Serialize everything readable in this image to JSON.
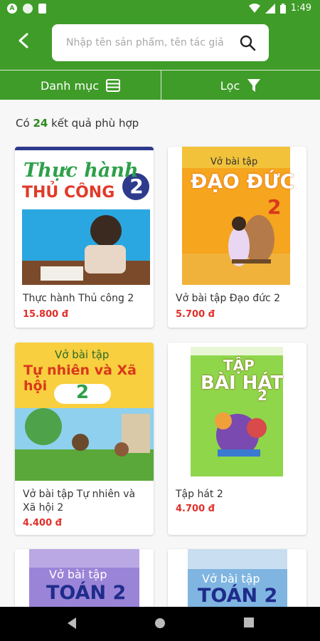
{
  "statusbar": {
    "time": "1:49"
  },
  "header": {
    "search_placeholder": "Nhập tên sản phẩm, tên tác giả"
  },
  "filterbar": {
    "category_label": "Danh mục",
    "filter_label": "Lọc"
  },
  "results": {
    "prefix": "Có",
    "count": "24",
    "suffix": "kết quả phù hợp"
  },
  "products": [
    {
      "title": "Thực hành Thủ công 2",
      "price": "15.800 đ",
      "cover_line1": "Thực hành",
      "cover_line2": "THỦ CÔNG",
      "cover_num": "2"
    },
    {
      "title": "Vở bài tập Đạo đức 2",
      "price": "5.700 đ",
      "cover_line1": "Vở bài tập",
      "cover_line2": "ĐẠO ĐỨC",
      "cover_num": "2"
    },
    {
      "title": "Vở bài tập Tự nhiên và Xã hội 2",
      "price": "4.400 đ",
      "cover_line1": "Vở bài tập",
      "cover_line2": "Tự nhiên và Xã hội",
      "cover_num": "2"
    },
    {
      "title": "Tập hát 2",
      "price": "4.700 đ",
      "cover_line1": "TẬP",
      "cover_line2": "BÀI HÁT",
      "cover_num": "2"
    },
    {
      "cover_line1": "Vở bài tập",
      "cover_line2": "TOÁN 2"
    },
    {
      "cover_line1": "Vở bài tập",
      "cover_line2": "TOÁN 2"
    }
  ],
  "colors": {
    "brand_green": "#3f9c28",
    "price_red": "#e0302a",
    "count_green": "#2e8b20"
  }
}
